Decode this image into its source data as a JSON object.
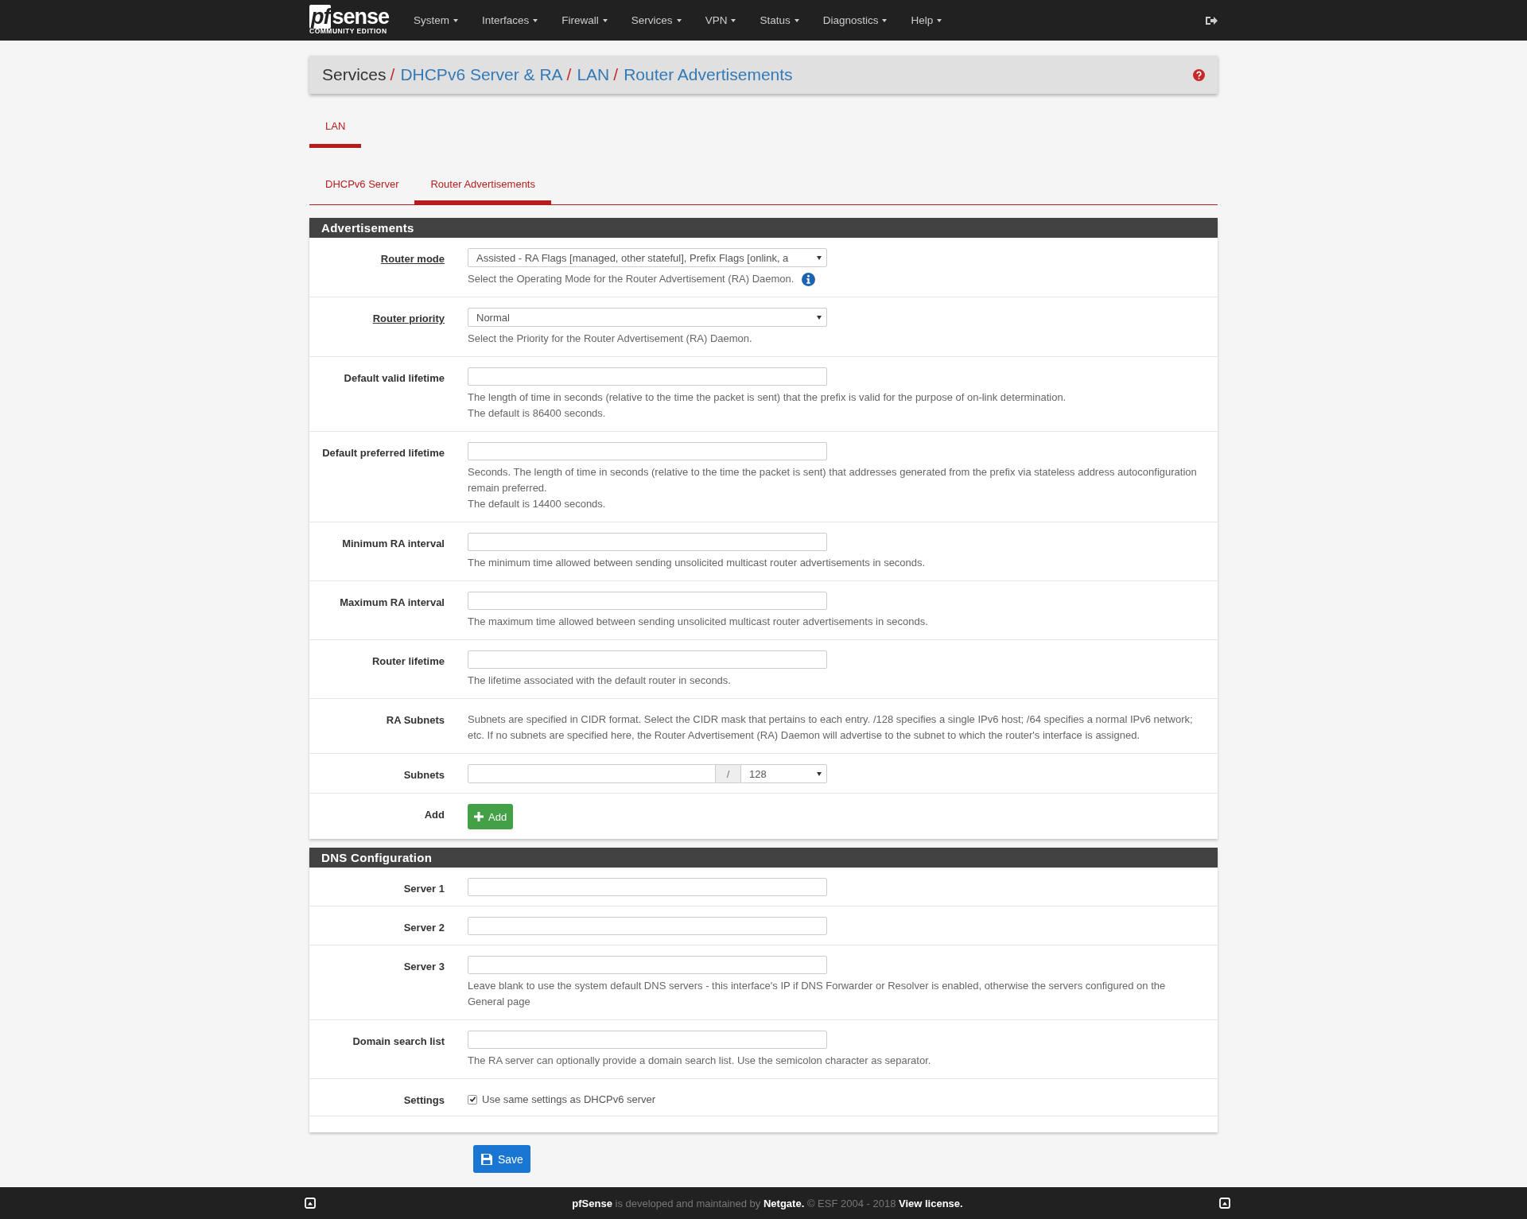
{
  "navbar": {
    "logo": "sense",
    "logo_prefix": "pf",
    "logo_sub": "COMMUNITY EDITION",
    "menus": [
      "System",
      "Interfaces",
      "Firewall",
      "Services",
      "VPN",
      "Status",
      "Diagnostics",
      "Help"
    ]
  },
  "breadcrumb": [
    {
      "text": "Services",
      "link": false,
      "separator": "/"
    },
    {
      "text": "DHCPv6 Server & RA",
      "link": true,
      "separator": "/"
    },
    {
      "text": "LAN",
      "link": true,
      "separator": "/"
    },
    {
      "text": "Router Advertisements",
      "link": true
    }
  ],
  "interface_tabs": [
    {
      "label": "LAN",
      "selected": true
    }
  ],
  "sub_tabs": [
    {
      "label": "DHCPv6 Server",
      "selected": false
    },
    {
      "label": "Router Advertisements",
      "selected": true
    }
  ],
  "sections": [
    {
      "title": "Advertisements",
      "rows": [
        {
          "kind": "select",
          "label": "Router mode",
          "label_link": true,
          "value": "Assisted - RA Flags [managed, other stateful], Prefix Flags [onlink, a",
          "help": [
            "Select the Operating Mode for the Router Advertisement (RA) Daemon."
          ],
          "info_icon": true
        },
        {
          "kind": "select",
          "label": "Router priority",
          "label_link": true,
          "value": "Normal",
          "help": [
            "Select the Priority for the Router Advertisement (RA) Daemon."
          ]
        },
        {
          "kind": "input",
          "label": "Default valid lifetime",
          "help": [
            "The length of time in seconds (relative to the time the packet is sent) that the prefix is valid for the purpose of on-link determination.",
            "The default is 86400 seconds."
          ]
        },
        {
          "kind": "input",
          "label": "Default preferred lifetime",
          "help": [
            "Seconds. The length of time in seconds (relative to the time the packet is sent) that addresses generated from the prefix via stateless address autoconfiguration remain preferred.",
            "The default is 14400 seconds."
          ]
        },
        {
          "kind": "input",
          "label": "Minimum RA interval",
          "help": [
            "The minimum time allowed between sending unsolicited multicast router advertisements in seconds."
          ]
        },
        {
          "kind": "input",
          "label": "Maximum RA interval",
          "help": [
            "The maximum time allowed between sending unsolicited multicast router advertisements in seconds."
          ]
        },
        {
          "kind": "input",
          "label": "Router lifetime",
          "help": [
            "The lifetime associated with the default router in seconds."
          ]
        },
        {
          "kind": "text",
          "label": "RA Subnets",
          "help": [
            "Subnets are specified in CIDR format. Select the CIDR mask that pertains to each entry. /128 specifies a single IPv6 host; /64 specifies a normal IPv6 network; etc. If no subnets are specified here, the Router Advertisement (RA) Daemon will advertise to the subnet to which the router's interface is assigned."
          ]
        },
        {
          "kind": "subnet",
          "label": "Subnets",
          "separator": "/",
          "mask": "128"
        },
        {
          "kind": "button",
          "label": "Add",
          "button": "Add"
        }
      ]
    },
    {
      "title": "DNS Configuration",
      "rows": [
        {
          "kind": "input",
          "label": "Server 1"
        },
        {
          "kind": "input",
          "label": "Server 2"
        },
        {
          "kind": "input",
          "label": "Server 3",
          "help": [
            "Leave blank to use the system default DNS servers - this interface's IP if DNS Forwarder or Resolver is enabled, otherwise the servers configured on the General page"
          ]
        },
        {
          "kind": "input",
          "label": "Domain search list",
          "help": [
            "The RA server can optionally provide a domain search list. Use the semicolon character as separator."
          ]
        },
        {
          "kind": "checkbox",
          "label": "Settings",
          "checked": true,
          "text": "Use same settings as DHCPv6 server"
        }
      ]
    }
  ],
  "save_button": "Save",
  "footer": "**pfSense** is developed and maintained by **Netgate.** © ESF 2004 - 2018 **View license.**"
}
